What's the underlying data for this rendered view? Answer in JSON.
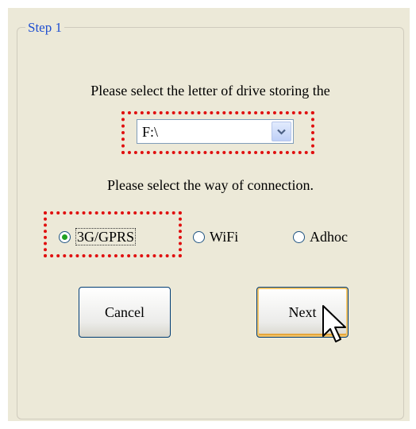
{
  "group": {
    "legend": "Step 1"
  },
  "drive": {
    "prompt": "Please select the letter of drive storing the",
    "selected": "F:\\"
  },
  "connection": {
    "prompt": "Please select the way of connection.",
    "options": [
      {
        "label": "3G/GPRS",
        "checked": true
      },
      {
        "label": "WiFi",
        "checked": false
      },
      {
        "label": "Adhoc",
        "checked": false
      }
    ]
  },
  "buttons": {
    "cancel": "Cancel",
    "next": "Next"
  },
  "colors": {
    "legend": "#1f4fd1",
    "highlight_dots": "#e01010",
    "dialog_bg": "#ece9d8",
    "radio_dot": "#21a121"
  },
  "icons": [
    "chevron-down-icon",
    "mouse-pointer-icon"
  ]
}
